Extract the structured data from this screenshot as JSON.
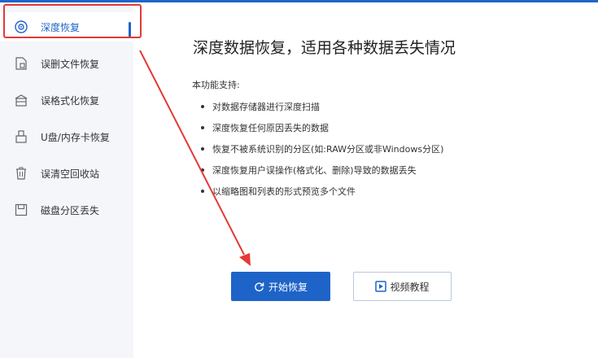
{
  "sidebar": {
    "items": [
      {
        "label": "深度恢复",
        "icon": "scan-target-icon",
        "active": true
      },
      {
        "label": "误删文件恢复",
        "icon": "deleted-file-icon"
      },
      {
        "label": "误格式化恢复",
        "icon": "format-drive-icon"
      },
      {
        "label": "U盘/内存卡恢复",
        "icon": "usb-drive-icon"
      },
      {
        "label": "误清空回收站",
        "icon": "recycle-bin-icon"
      },
      {
        "label": "磁盘分区丢失",
        "icon": "disk-partition-icon"
      }
    ]
  },
  "main": {
    "title": "深度数据恢复，适用各种数据丢失情况",
    "support_label": "本功能支持:",
    "features": [
      "对数据存储器进行深度扫描",
      "深度恢复任何原因丢失的数据",
      "恢复不被系统识别的分区(如:RAW分区或非Windows分区)",
      "深度恢复用户误操作(格式化、删除)导致的数据丢失",
      "以缩略图和列表的形式预览多个文件"
    ],
    "start_button": "开始恢复",
    "video_button": "视频教程"
  },
  "colors": {
    "accent": "#1e64c8",
    "annotation": "#e53935",
    "sidebar_bg": "#f4f6fa"
  }
}
